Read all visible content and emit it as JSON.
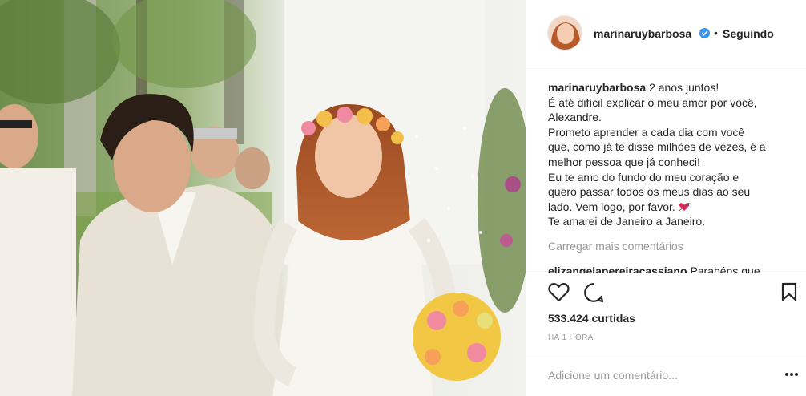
{
  "post": {
    "photo_alt": "",
    "username": "marinaruybarbosa",
    "verified": true,
    "separator": "•",
    "follow_status": "Seguindo"
  },
  "caption": {
    "username": "marinaruybarbosa",
    "lines": [
      "2 anos juntos!",
      "É até difícil explicar o meu amor por você,",
      "Alexandre.",
      "Prometo aprender a cada dia com você",
      "que, como já te disse milhões de vezes, é a",
      "melhor pessoa que já conheci!",
      "Eu te amo do fundo do meu coração e",
      "quero passar todos os meus dias ao seu",
      "lado. Vem logo, por favor.",
      "Te amarei de Janeiro a Janeiro."
    ],
    "emoji_icon": "heart-with-arrow-icon"
  },
  "comments": {
    "load_more": "Carregar mais comentários",
    "next": {
      "username": "elizangelapereiracassiano",
      "text": "Parabéns que"
    }
  },
  "actions": {
    "like_icon": "heart-outline-icon",
    "comment_icon": "speech-bubble-icon",
    "save_icon": "bookmark-icon"
  },
  "likes": "533.424 curtidas",
  "timestamp": "HÁ 1 HORA",
  "add_comment": {
    "placeholder": "Adicione um comentário...",
    "options_icon": "more-options-icon"
  },
  "colors": {
    "text": "#262626",
    "muted": "#999999",
    "verified_blue": "#3897f0",
    "divider": "#efefef",
    "emoji_red": "#e0245e"
  }
}
